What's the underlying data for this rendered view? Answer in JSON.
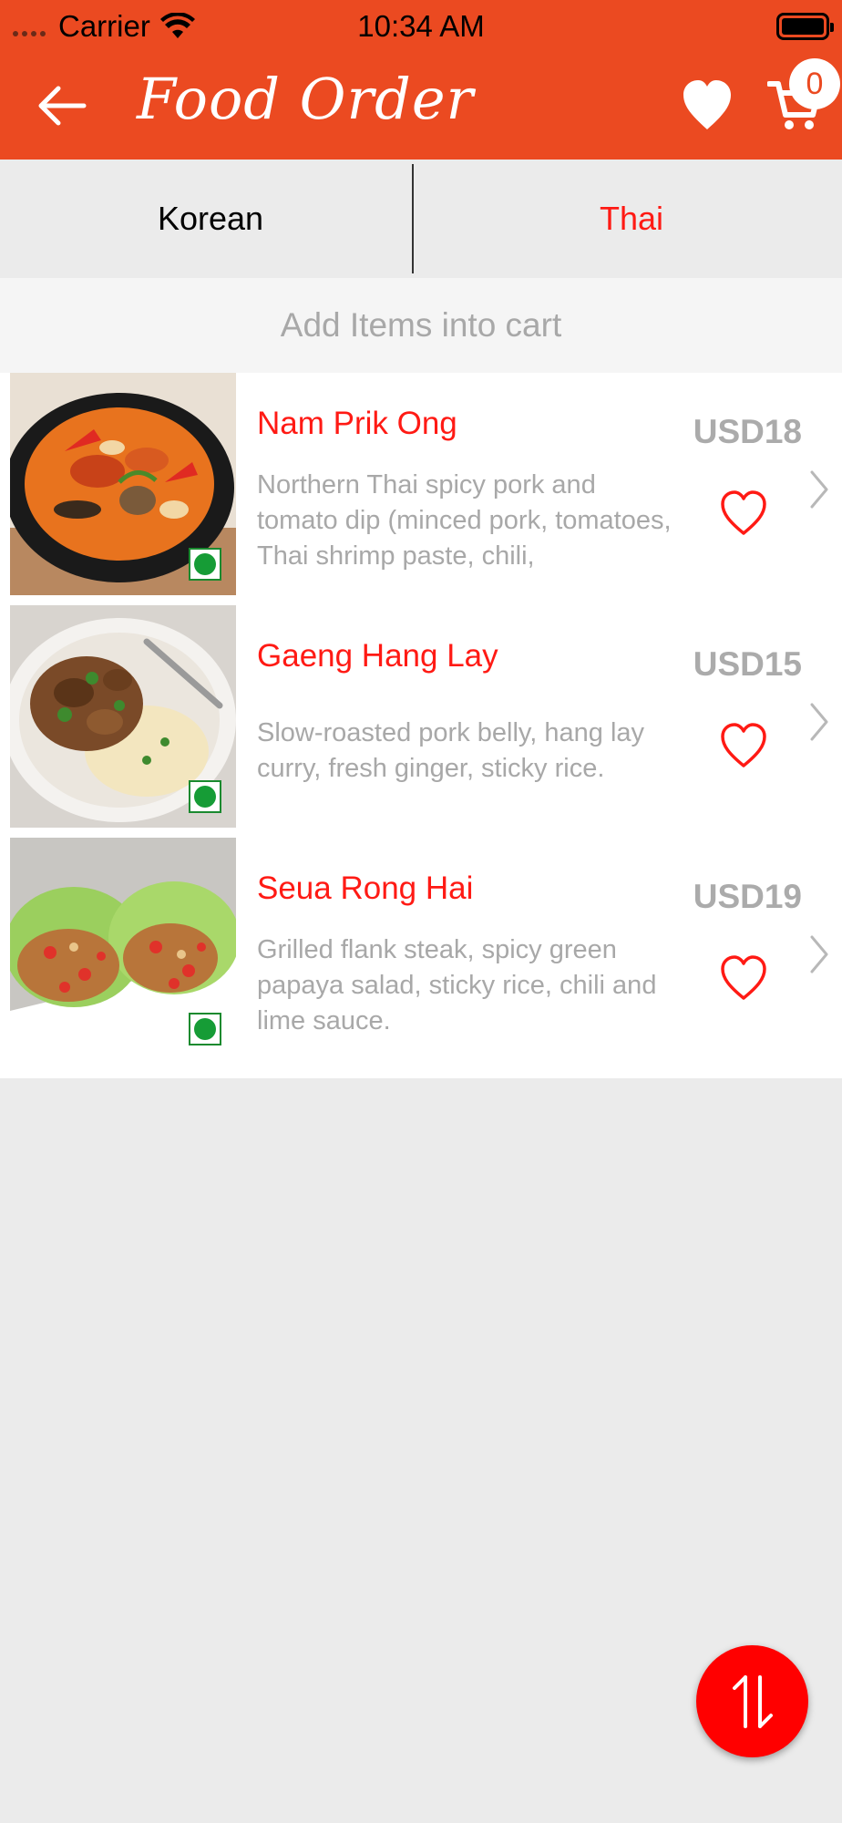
{
  "status_bar": {
    "carrier": "Carrier",
    "time": "10:34 AM"
  },
  "header": {
    "title": "Food Order",
    "cart_count": "0",
    "back_icon": "arrow-left-icon",
    "favorites_icon": "heart-icon",
    "cart_icon": "cart-icon"
  },
  "tabs": [
    {
      "label": "Korean",
      "active": false
    },
    {
      "label": "Thai",
      "active": true
    }
  ],
  "notice": "Add Items into cart",
  "items": [
    {
      "name": "Nam Prik Ong",
      "description": "Northern Thai spicy pork and tomato dip (minced pork, tomatoes, Thai shrimp paste, chili,",
      "price": "USD18",
      "veg": true,
      "liked": false
    },
    {
      "name": "Gaeng Hang Lay",
      "description": "Slow-roasted pork belly, hang lay curry, fresh ginger, sticky rice.",
      "price": "USD15",
      "veg": true,
      "liked": false
    },
    {
      "name": "Seua Rong Hai",
      "description": "Grilled flank steak, spicy green papaya salad, sticky rice, chili and lime sauce.",
      "price": "USD19",
      "veg": true,
      "liked": false
    }
  ],
  "fab_icon": "sort-arrows-icon",
  "colors": {
    "brand": "#eb4a21",
    "accent_red": "#ff1a14",
    "background": "#ebebeb",
    "veg_green": "#169c36"
  }
}
